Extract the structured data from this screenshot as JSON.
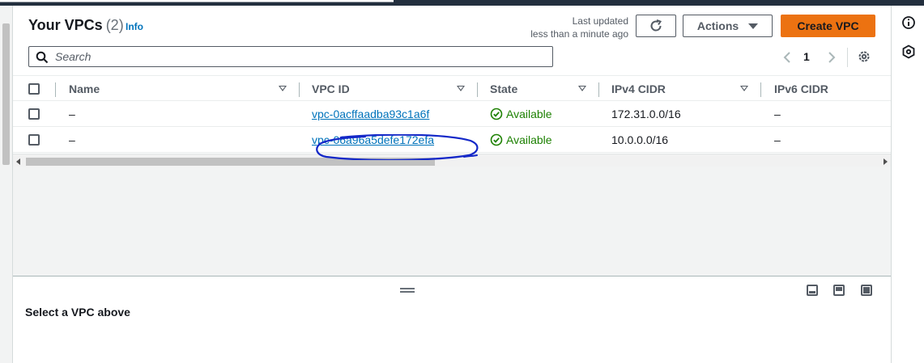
{
  "header": {
    "title": "Your VPCs",
    "count": "(2)",
    "info_label": "Info",
    "last_updated_label": "Last updated",
    "last_updated_value": "less than a minute ago",
    "actions_label": "Actions",
    "create_label": "Create VPC"
  },
  "search": {
    "placeholder": "Search",
    "value": ""
  },
  "pagination": {
    "current_page": "1"
  },
  "table": {
    "columns": [
      "Name",
      "VPC ID",
      "State",
      "IPv4 CIDR",
      "IPv6 CIDR"
    ],
    "rows": [
      {
        "name": "–",
        "vpc_id": "vpc-0acffaadba93c1a6f",
        "state": "Available",
        "ipv4_cidr": "172.31.0.0/16",
        "ipv6_cidr": "–"
      },
      {
        "name": "–",
        "vpc_id": "vpc-06a96a5defe172efa",
        "state": "Available",
        "ipv4_cidr": "10.0.0.0/16",
        "ipv6_cidr": "–"
      }
    ]
  },
  "detail_panel": {
    "message": "Select a VPC above"
  },
  "icons": {
    "refresh": "refresh-icon",
    "search": "search-icon",
    "settings": "gear-icon",
    "status_ok": "check-circle-icon",
    "info": "info-icon",
    "tutorial": "hexagon-icon"
  },
  "colors": {
    "primary_button": "#ec7211",
    "link": "#0073bb",
    "status_success": "#1d8102",
    "annotation_ink": "#1428c8"
  }
}
